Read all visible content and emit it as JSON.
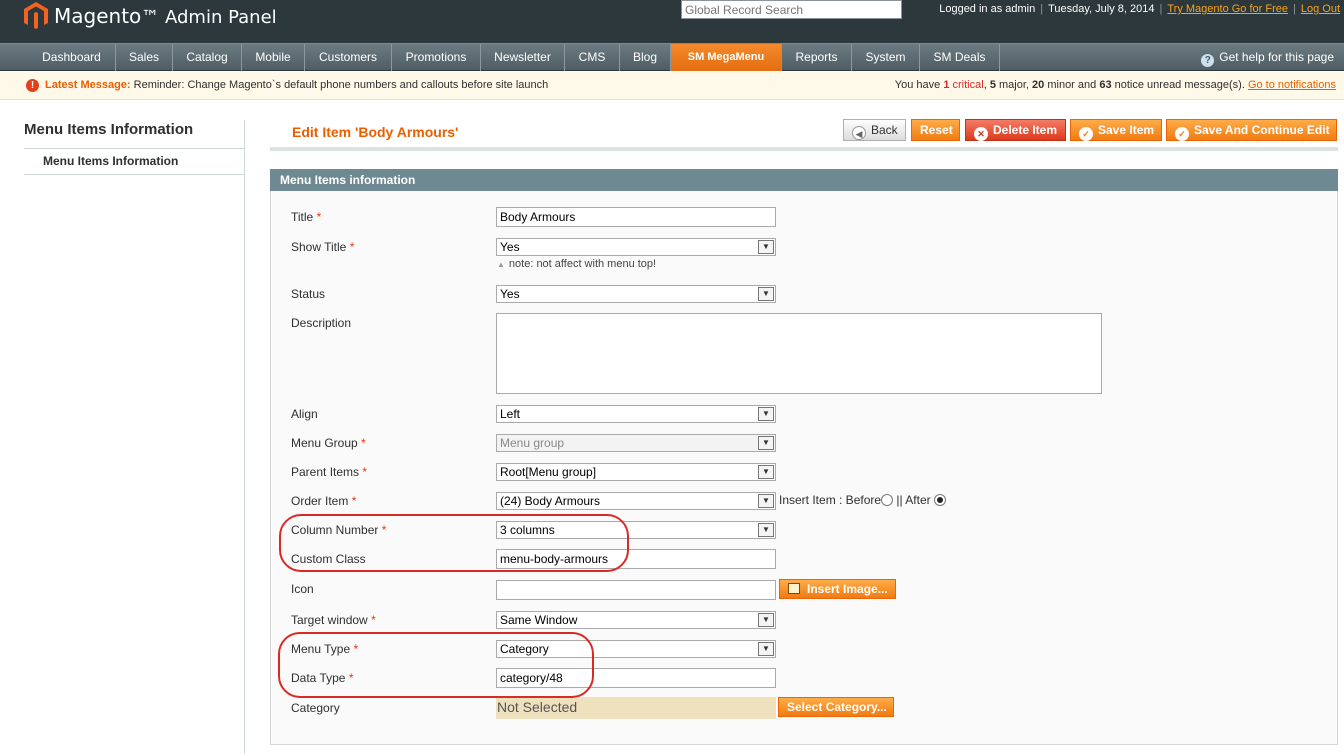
{
  "header": {
    "brand": "Magento",
    "panel_title": "Admin Panel",
    "search_placeholder": "Global Record Search",
    "logged_in": "Logged in as admin",
    "date": "Tuesday, July 8, 2014",
    "try_link": "Try Magento Go for Free",
    "logout": "Log Out"
  },
  "nav": {
    "items": [
      "Dashboard",
      "Sales",
      "Catalog",
      "Mobile",
      "Customers",
      "Promotions",
      "Newsletter",
      "CMS",
      "Blog",
      "SM MegaMenu",
      "Reports",
      "System",
      "SM Deals"
    ],
    "active": "SM MegaMenu",
    "help": "Get help for this page"
  },
  "message": {
    "label": "Latest Message:",
    "text": "Reminder: Change Magento`s default phone numbers and callouts before site launch",
    "right_prefix": "You have",
    "critical_count": "1",
    "critical_word": "critical",
    "major": "5",
    "major_word": "major,",
    "minor": "20",
    "minor_word": "minor and",
    "notice": "63",
    "notice_word": "notice unread message(s).",
    "link": "Go to notifications"
  },
  "sidebar": {
    "title": "Menu Items Information",
    "tab": "Menu Items Information"
  },
  "page": {
    "title": "Edit Item 'Body Armours'",
    "buttons": {
      "back": "Back",
      "reset": "Reset",
      "delete": "Delete Item",
      "save": "Save Item",
      "save_continue": "Save And Continue Edit"
    },
    "fieldset_title": "Menu Items information"
  },
  "form": {
    "title_label": "Title",
    "title_value": "Body Armours",
    "show_title_label": "Show Title",
    "show_title_value": "Yes",
    "show_title_note": "note: not affect with menu top!",
    "status_label": "Status",
    "status_value": "Yes",
    "description_label": "Description",
    "align_label": "Align",
    "align_value": "Left",
    "menu_group_label": "Menu Group",
    "menu_group_value": "Menu group",
    "parent_items_label": "Parent Items",
    "parent_items_value": "Root[Menu group]",
    "order_item_label": "Order Item",
    "order_item_value": "(24) Body Armours",
    "insert_item_label": "Insert Item : Before",
    "insert_after_label": "|| After",
    "insert_selected": "After",
    "column_number_label": "Column Number",
    "column_number_value": "3 columns",
    "custom_class_label": "Custom Class",
    "custom_class_value": "menu-body-armours",
    "icon_label": "Icon",
    "insert_image_button": "Insert Image...",
    "target_window_label": "Target window",
    "target_window_value": "Same Window",
    "menu_type_label": "Menu Type",
    "menu_type_value": "Category",
    "data_type_label": "Data Type",
    "data_type_value": "category/48",
    "category_label": "Category",
    "category_value": "Not Selected",
    "select_category_button": "Select Category...",
    "required_mark": "*"
  },
  "colors": {
    "header_bg": "#2c383c",
    "accent_orange": "#eb5e00",
    "button_orange": "#f07b13",
    "annotation_red": "#d92b26"
  }
}
